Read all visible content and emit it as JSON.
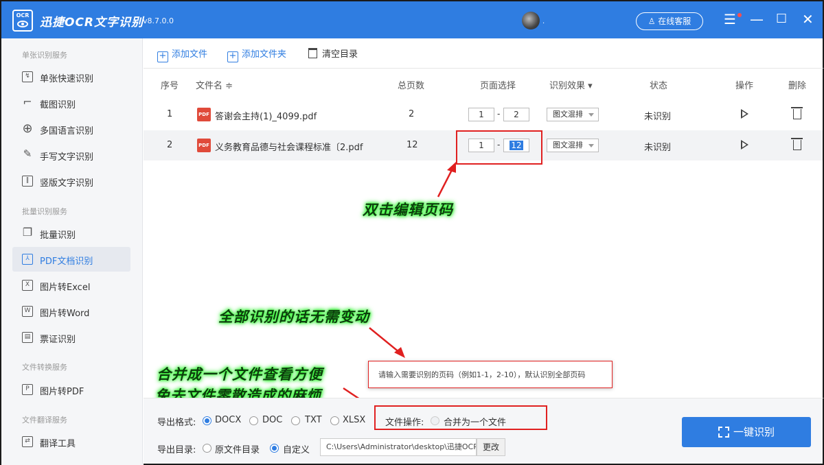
{
  "window": {
    "app_title": "迅捷OCR文字识别",
    "version": "v8.7.0.0",
    "logo_text": "OCR",
    "avatar_suffix": ".",
    "support_label": "在线客服",
    "menu_icon": "☰",
    "minimize_icon": "—",
    "maximize_icon": "☐",
    "close_icon": "✕"
  },
  "sidebar": {
    "sections": [
      {
        "title": "单张识别服务"
      },
      {
        "title": "批量识别服务"
      },
      {
        "title": "文件转换服务"
      },
      {
        "title": "文件翻译服务"
      }
    ],
    "items": [
      {
        "label": "单张快速识别",
        "icon": "single-image-icon",
        "glyph": "↯"
      },
      {
        "label": "截图识别",
        "icon": "crop-icon",
        "glyph": "⌐"
      },
      {
        "label": "多国语言识别",
        "icon": "globe-icon",
        "glyph": "⊕"
      },
      {
        "label": "手写文字识别",
        "icon": "pen-icon",
        "glyph": "✎"
      },
      {
        "label": "竖版文字识别",
        "icon": "vertical-text-icon",
        "glyph": "‖"
      },
      {
        "label": "批量识别",
        "icon": "batch-icon",
        "glyph": "❐"
      },
      {
        "label": "PDF文档识别",
        "icon": "pdf-doc-icon",
        "glyph": "⅄",
        "active": true
      },
      {
        "label": "图片转Excel",
        "icon": "excel-icon",
        "glyph": "X"
      },
      {
        "label": "图片转Word",
        "icon": "word-icon",
        "glyph": "W"
      },
      {
        "label": "票证识别",
        "icon": "ticket-icon",
        "glyph": "▤"
      },
      {
        "label": "图片转PDF",
        "icon": "pdf-convert-icon",
        "glyph": "P"
      },
      {
        "label": "翻译工具",
        "icon": "translate-icon",
        "glyph": "⇄"
      }
    ]
  },
  "toolbar": {
    "add_file": "添加文件",
    "add_folder": "添加文件夹",
    "clear_list": "清空目录",
    "plus_glyph": "+"
  },
  "table": {
    "headers": {
      "index": "序号",
      "filename": "文件名 ≑",
      "total_pages": "总页数",
      "page_select": "页面选择",
      "effect": "识别效果 ▾",
      "status": "状态",
      "action": "操作",
      "delete": "删除"
    },
    "pdf_icon_text": "PDF",
    "page_dash": "-",
    "rows": [
      {
        "index": "1",
        "filename": "答谢会主持(1)_4099.pdf",
        "total_pages": "2",
        "page_from": "1",
        "page_to": "2",
        "effect": "图文混排",
        "status": "未识别"
      },
      {
        "index": "2",
        "filename": "义务教育品德与社会课程标准〔2.pdf",
        "total_pages": "12",
        "page_from": "1",
        "page_to": "12",
        "effect": "图文混排",
        "status": "未识别"
      }
    ]
  },
  "annotations": {
    "double_click": "双击编辑页码",
    "no_change": "全部识别的话无需变动",
    "merge_line1": "合并成一个文件查看方便",
    "merge_line2": "免去文件零散造成的麻烦",
    "tooltip": "请输入需要识别的页码（例如1-1，2-10），默认识别全部页码"
  },
  "bottom": {
    "format_label": "导出格式:",
    "formats": [
      "DOCX",
      "DOC",
      "TXT",
      "XLSX"
    ],
    "selected_format": "DOCX",
    "file_op_label": "文件操作:",
    "merge_label": "合并为一个文件",
    "dir_label": "导出目录:",
    "dir_source": "原文件目录",
    "dir_custom": "自定义",
    "path_value": "C:\\Users\\Administrator\\desktop\\迅捷OCR文",
    "change_label": "更改",
    "start_label": "一键识别"
  },
  "colors": {
    "accent": "#2f7de1",
    "annotation_red": "#e02020",
    "annotation_glow": "#40ff40"
  }
}
